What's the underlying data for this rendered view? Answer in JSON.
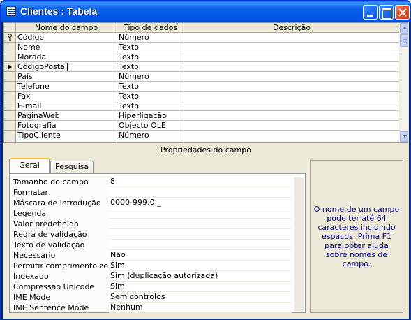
{
  "window": {
    "title": "Clientes : Tabela"
  },
  "grid": {
    "headers": [
      "Nome do campo",
      "Tipo de dados",
      "Descrição"
    ],
    "rows": [
      {
        "name": "Código",
        "type": "Número",
        "description": "",
        "marker": "key"
      },
      {
        "name": "Nome",
        "type": "Texto",
        "description": "",
        "marker": ""
      },
      {
        "name": "Morada",
        "type": "Texto",
        "description": "",
        "marker": ""
      },
      {
        "name": "CódigoPostal",
        "type": "Texto",
        "description": "",
        "marker": "current"
      },
      {
        "name": "País",
        "type": "Número",
        "description": "",
        "marker": ""
      },
      {
        "name": "Telefone",
        "type": "Texto",
        "description": "",
        "marker": ""
      },
      {
        "name": "Fax",
        "type": "Texto",
        "description": "",
        "marker": ""
      },
      {
        "name": "E-mail",
        "type": "Texto",
        "description": "",
        "marker": ""
      },
      {
        "name": "PáginaWeb",
        "type": "Hiperligação",
        "description": "",
        "marker": ""
      },
      {
        "name": "Fotografia",
        "type": "Objecto OLE",
        "description": "",
        "marker": ""
      },
      {
        "name": "TipoCliente",
        "type": "Número",
        "description": "",
        "marker": ""
      }
    ]
  },
  "properties": {
    "section_title": "Propriedades do campo",
    "tabs": [
      "Geral",
      "Pesquisa"
    ],
    "active_tab": "Geral",
    "rows": [
      {
        "label": "Tamanho do campo",
        "value": "8"
      },
      {
        "label": "Formatar",
        "value": ""
      },
      {
        "label": "Máscara de introdução",
        "value": "0000-999;0;_"
      },
      {
        "label": "Legenda",
        "value": ""
      },
      {
        "label": "Valor predefinido",
        "value": ""
      },
      {
        "label": "Regra de validação",
        "value": ""
      },
      {
        "label": "Texto de validação",
        "value": ""
      },
      {
        "label": "Necessário",
        "value": "Não"
      },
      {
        "label": "Permitir comprimento zero",
        "value": "Sim"
      },
      {
        "label": "Indexado",
        "value": "Sim (duplicação autorizada)"
      },
      {
        "label": "Compressão Unicode",
        "value": "Sim"
      },
      {
        "label": "IME Mode",
        "value": "Sem controlos"
      },
      {
        "label": "IME Sentence Mode",
        "value": "Nenhum"
      }
    ],
    "help_text": "O nome de um campo pode ter até 64 caracteres incluindo espaços. Prima F1 para obter ajuda sobre nomes de campo."
  },
  "icons": {
    "window": "table-icon",
    "primary_key": "key-icon",
    "current_row": "row-pointer-icon"
  },
  "colors": {
    "titlebar": "#0a5fe8",
    "help_text": "#00008b",
    "tab_highlight": "#ffc83c"
  }
}
